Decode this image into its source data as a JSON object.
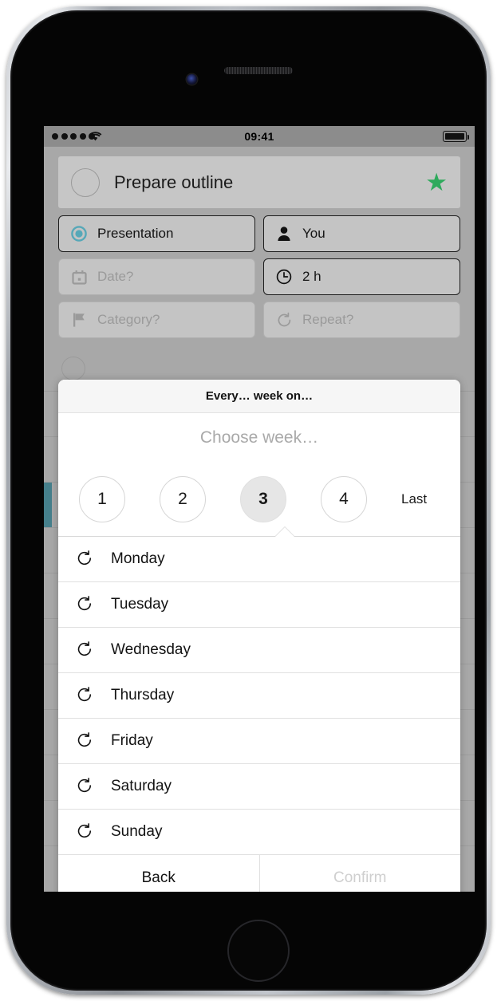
{
  "status_bar": {
    "time": "09:41",
    "signal_dots": 5,
    "wifi_icon": "wifi-icon",
    "battery_icon": "battery-full-icon"
  },
  "task": {
    "title": "Prepare outline",
    "checkbox_icon": "circle-checkbox-icon",
    "star_icon": "star-icon",
    "star_color": "#2eaa5c",
    "accent_color": "#46808c"
  },
  "chips": [
    {
      "label": "Presentation",
      "icon": "radio-selected-icon",
      "state": "active",
      "icon_color": "#56a8b8"
    },
    {
      "label": "You",
      "icon": "person-icon",
      "state": "active"
    },
    {
      "label": "Date?",
      "icon": "calendar-icon",
      "state": "empty"
    },
    {
      "label": "2 h",
      "icon": "clock-icon",
      "state": "active"
    },
    {
      "label": "Category?",
      "icon": "flag-icon",
      "state": "empty"
    },
    {
      "label": "Repeat?",
      "icon": "repeat-icon",
      "state": "empty"
    }
  ],
  "modal": {
    "title": "Every… week on…",
    "subtitle": "Choose week…",
    "week_options": [
      {
        "label": "1",
        "selected": false
      },
      {
        "label": "2",
        "selected": false
      },
      {
        "label": "3",
        "selected": true
      },
      {
        "label": "4",
        "selected": false
      }
    ],
    "last_label": "Last",
    "days": [
      {
        "label": "Monday",
        "icon": "repeat-icon"
      },
      {
        "label": "Tuesday",
        "icon": "repeat-icon"
      },
      {
        "label": "Wednesday",
        "icon": "repeat-icon"
      },
      {
        "label": "Thursday",
        "icon": "repeat-icon"
      },
      {
        "label": "Friday",
        "icon": "repeat-icon"
      },
      {
        "label": "Saturday",
        "icon": "repeat-icon"
      },
      {
        "label": "Sunday",
        "icon": "repeat-icon"
      }
    ],
    "back_label": "Back",
    "confirm_label": "Confirm",
    "confirm_enabled": false
  }
}
